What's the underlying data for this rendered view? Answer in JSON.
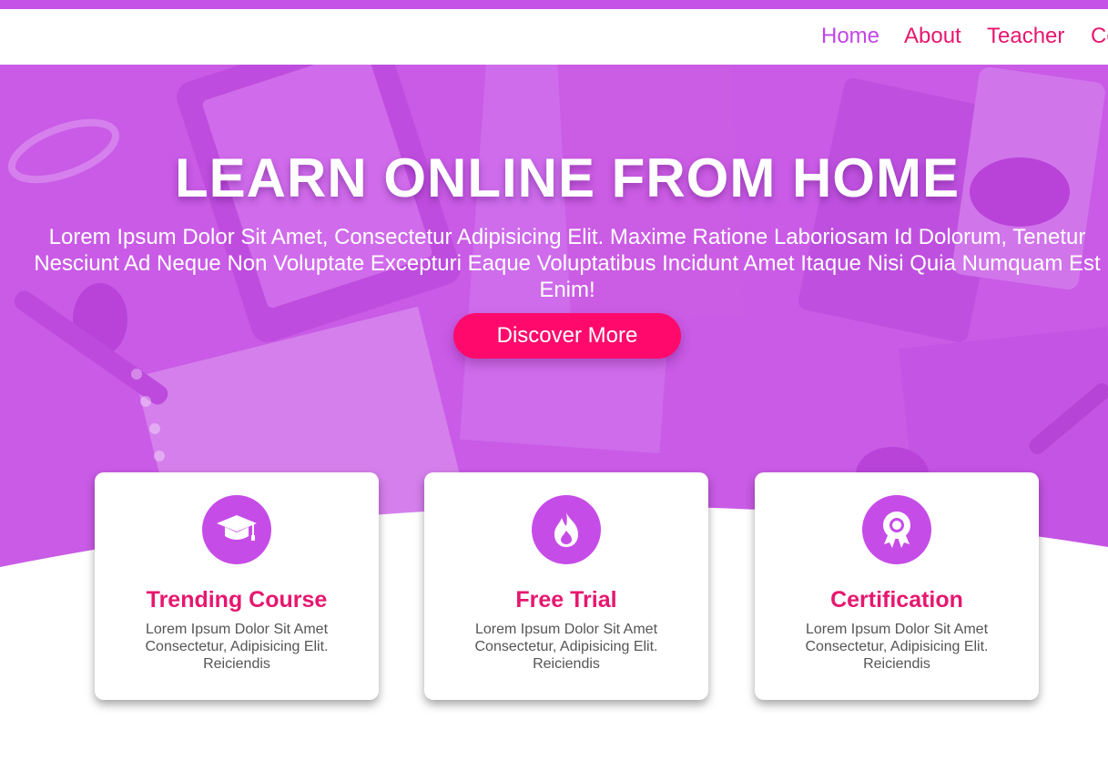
{
  "nav": {
    "items": [
      {
        "label": "Home"
      },
      {
        "label": "About"
      },
      {
        "label": "Teacher"
      },
      {
        "label": "Co"
      }
    ]
  },
  "hero": {
    "title": "LEARN ONLINE FROM HOME",
    "text": "Lorem Ipsum Dolor Sit Amet, Consectetur Adipisicing Elit. Maxime Ratione Laboriosam Id Dolorum, Tenetur Nesciunt Ad Neque Non Voluptate Excepturi Eaque Voluptatibus Incidunt Amet Itaque Nisi Quia Numquam Est Enim!",
    "button_label": "Discover More"
  },
  "features": [
    {
      "icon": "graduation-cap-icon",
      "title": "Trending Course",
      "text": "Lorem Ipsum Dolor Sit Amet Consectetur, Adipisicing Elit. Reiciendis"
    },
    {
      "icon": "fire-icon",
      "title": "Free Trial",
      "text": "Lorem Ipsum Dolor Sit Amet Consectetur, Adipisicing Elit. Reiciendis"
    },
    {
      "icon": "award-icon",
      "title": "Certification",
      "text": "Lorem Ipsum Dolor Sit Amet Consectetur, Adipisicing Elit. Reiciendis"
    }
  ],
  "colors": {
    "primary": "#c64ce8",
    "accent": "#ff0a6c",
    "heading": "#e6176f",
    "nav_active": "#c345e8"
  }
}
